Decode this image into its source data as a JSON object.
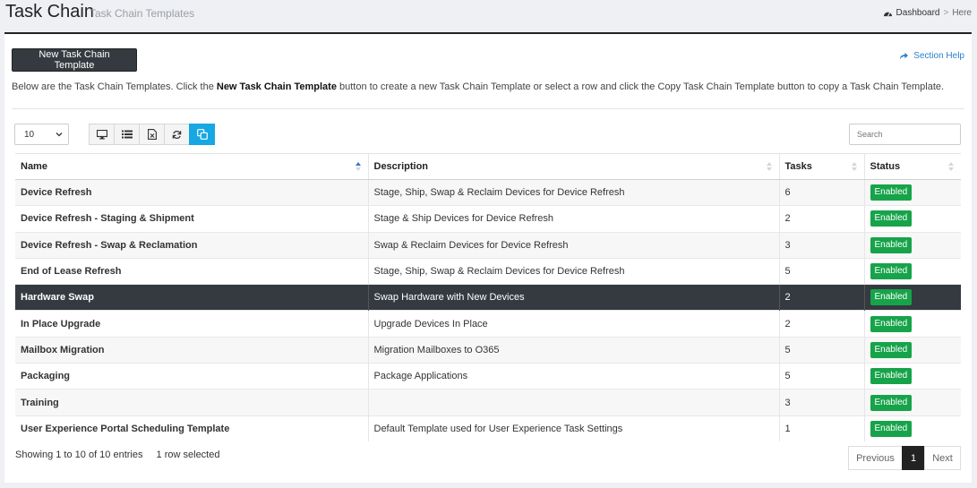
{
  "header": {
    "title": "Task Chain",
    "subtitle": "Task Chain Templates",
    "breadcrumb": {
      "dashboard": "Dashboard",
      "separator": ">",
      "current": "Here"
    }
  },
  "panel": {
    "new_button": "New Task Chain Template",
    "section_help": "Section Help",
    "intro_before": "Below are the Task Chain Templates. Click the ",
    "intro_bold": "New Task Chain Template",
    "intro_after": " button to create a new Task Chain Template or select a row and click the Copy Task Chain Template button to copy a Task Chain Template."
  },
  "controls": {
    "page_length": "10",
    "search_placeholder": "Search",
    "toolbar": [
      "monitor-icon",
      "list-icon",
      "excel-icon",
      "refresh-icon",
      "copy-icon"
    ]
  },
  "table": {
    "columns": [
      "Name",
      "Description",
      "Tasks",
      "Status"
    ],
    "rows": [
      {
        "name": "Device Refresh",
        "description": "Stage, Ship, Swap & Reclaim Devices for Device Refresh",
        "tasks": "6",
        "status": "Enabled"
      },
      {
        "name": "Device Refresh - Staging & Shipment",
        "description": "Stage & Ship Devices for Device Refresh",
        "tasks": "2",
        "status": "Enabled"
      },
      {
        "name": "Device Refresh - Swap & Reclamation",
        "description": "Swap & Reclaim Devices for Device Refresh",
        "tasks": "3",
        "status": "Enabled"
      },
      {
        "name": "End of Lease Refresh",
        "description": "Stage, Ship, Swap & Reclaim Devices for Device Refresh",
        "tasks": "5",
        "status": "Enabled"
      },
      {
        "name": "Hardware Swap",
        "description": "Swap Hardware with New Devices",
        "tasks": "2",
        "status": "Enabled",
        "selected": true
      },
      {
        "name": "In Place Upgrade",
        "description": "Upgrade Devices In Place",
        "tasks": "2",
        "status": "Enabled"
      },
      {
        "name": "Mailbox Migration",
        "description": "Migration Mailboxes to O365",
        "tasks": "5",
        "status": "Enabled"
      },
      {
        "name": "Packaging",
        "description": "Package Applications",
        "tasks": "5",
        "status": "Enabled"
      },
      {
        "name": "Training",
        "description": "",
        "tasks": "3",
        "status": "Enabled"
      },
      {
        "name": "User Experience Portal Scheduling Template",
        "description": "Default Template used for User Experience Task Settings",
        "tasks": "1",
        "status": "Enabled"
      }
    ]
  },
  "footer": {
    "showing": "Showing 1 to 10 of 10 entries",
    "selected": "1 row selected",
    "previous": "Previous",
    "current_page": "1",
    "next": "Next"
  },
  "colors": {
    "selected_row": "#343a40",
    "status_enabled": "#17a34a",
    "active_tool": "#17a8e3",
    "link": "#2a7fc9"
  }
}
